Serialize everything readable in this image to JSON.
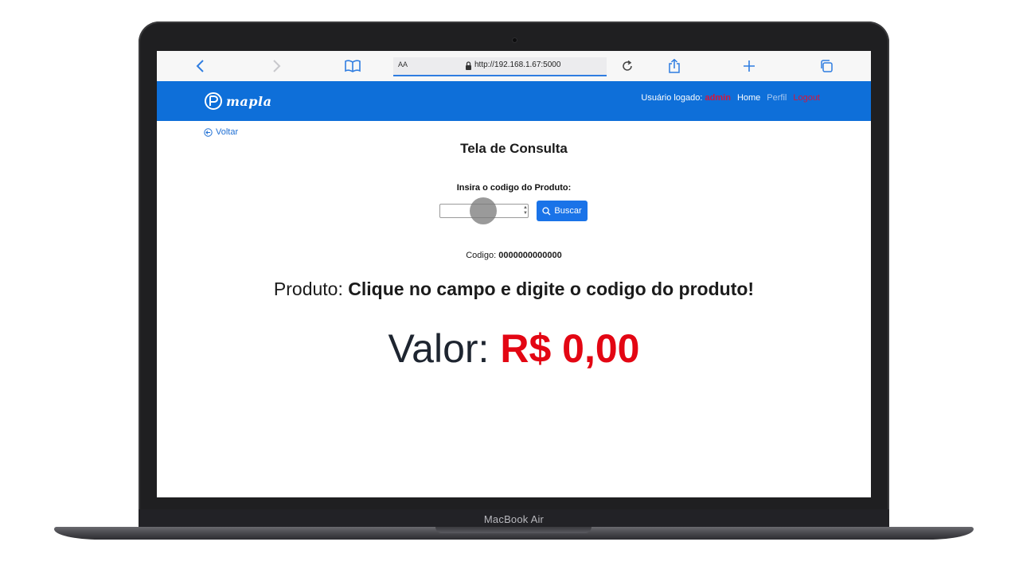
{
  "device": {
    "label": "MacBook Air"
  },
  "browser": {
    "text_size_label": "AA",
    "url": "http://192.168.1.67:5000",
    "icons": [
      "chevron-left-icon",
      "chevron-right-icon",
      "book-icon",
      "lock-icon",
      "reload-icon",
      "share-icon",
      "plus-icon",
      "tabs-icon"
    ]
  },
  "navbar": {
    "logo_text": "mapla",
    "user_label": "Usuário logado:",
    "user_name": "admin",
    "links": {
      "home": "Home",
      "profile": "Perfil",
      "logout": "Logout"
    }
  },
  "page": {
    "back_label": "Voltar",
    "title": "Tela de Consulta",
    "input_label": "Insira o codigo do Produto:",
    "input_value": "",
    "search_button": "Buscar",
    "code_label": "Codigo:",
    "code_value": "0000000000000",
    "product_label": "Produto:",
    "product_value": "Clique no campo e digite o codigo do produto!",
    "price_label": "Valor:",
    "price_value": "R$ 0,00"
  },
  "colors": {
    "navbar_bg": "#0e6fd9",
    "accent": "#1a73e8",
    "price": "#e30613",
    "user_highlight": "#d8153a"
  }
}
